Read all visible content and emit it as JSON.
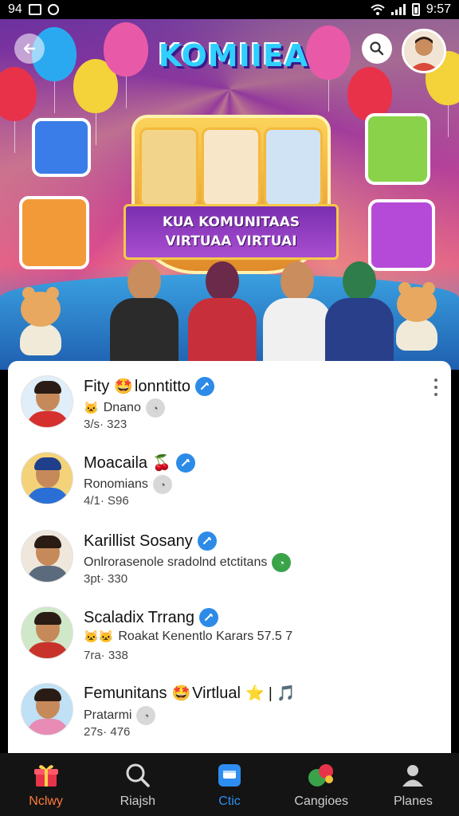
{
  "status_bar": {
    "left_text": "94",
    "time": "9:57"
  },
  "header": {
    "logo_text": "KOMIIEA",
    "banner_title": "KUA KOMUNITAAS VIRTUAA VIRTUAI"
  },
  "list": [
    {
      "name": "Fity",
      "name_suffix": "lonntitto",
      "name_emoji": "🤩",
      "subtitle": "Dnano",
      "subtitle_emoji": "🐱",
      "meta": "3/s· 323",
      "shirt_color": "#d6302e"
    },
    {
      "name": "Moacaila",
      "name_suffix": "",
      "name_emoji": "🍒",
      "subtitle": "Ronomians",
      "subtitle_emoji": "",
      "meta": "4/1· S96",
      "shirt_color": "#2a6fd6"
    },
    {
      "name": "Karillist Sosany",
      "name_suffix": "",
      "name_emoji": "",
      "subtitle": "Onlrorasenole sradolnd etctitans",
      "subtitle_emoji": "",
      "meta": "3pt· 330",
      "shirt_color": "#5b6b7d"
    },
    {
      "name": "Scaladix Trrang",
      "name_suffix": "",
      "name_emoji": "",
      "subtitle": "Roakat Kenentlo Karars 57.5 7",
      "subtitle_emoji": "🐱🐱",
      "meta": "7ra· 338",
      "shirt_color": "#c7332b"
    },
    {
      "name": "Femunitans",
      "name_suffix": "Virtlual",
      "name_emoji": "🤩",
      "name_trailing": "⭐ | 🎵",
      "subtitle": "Pratarmi",
      "subtitle_emoji": "",
      "meta": "27s· 476",
      "shirt_color": "#e88bb5"
    }
  ],
  "bottom_nav": [
    {
      "label": "Nclwy",
      "icon": "gift-icon"
    },
    {
      "label": "Riajsh",
      "icon": "search-icon"
    },
    {
      "label": "Ctic",
      "icon": "chat-icon"
    },
    {
      "label": "Cangioes",
      "icon": "stickers-icon"
    },
    {
      "label": "Planes",
      "icon": "person-icon"
    }
  ],
  "colors": {
    "accent": "#2e8df0",
    "verified": "#2d8be8",
    "active_first": "#ff7a3a",
    "nav_bg": "#141414"
  }
}
